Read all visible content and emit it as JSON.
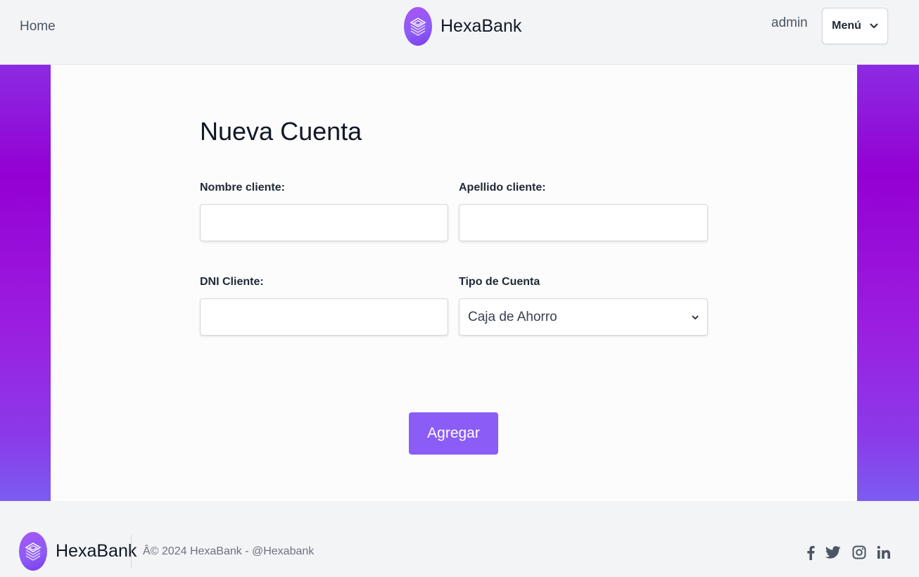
{
  "header": {
    "home_label": "Home",
    "brand_name": "HexaBank",
    "user_name": "admin",
    "menu_label": "Menú"
  },
  "form": {
    "title": "Nueva Cuenta",
    "nombre_label": "Nombre cliente:",
    "nombre_value": "",
    "apellido_label": "Apellido cliente:",
    "apellido_value": "",
    "dni_label": "DNI Cliente:",
    "dni_value": "",
    "tipo_label": "Tipo de Cuenta",
    "tipo_selected": "Caja de Ahorro",
    "submit_label": "Agregar"
  },
  "footer": {
    "brand_name": "HexaBank",
    "copyright": "Â© 2024 HexaBank  - @Hexabank",
    "socials": [
      "facebook-icon",
      "twitter-icon",
      "instagram-icon",
      "linkedin-icon"
    ]
  },
  "colors": {
    "accent": "#8b5cf6",
    "side_band": "#9400d3",
    "background": "#f3f4f6"
  }
}
